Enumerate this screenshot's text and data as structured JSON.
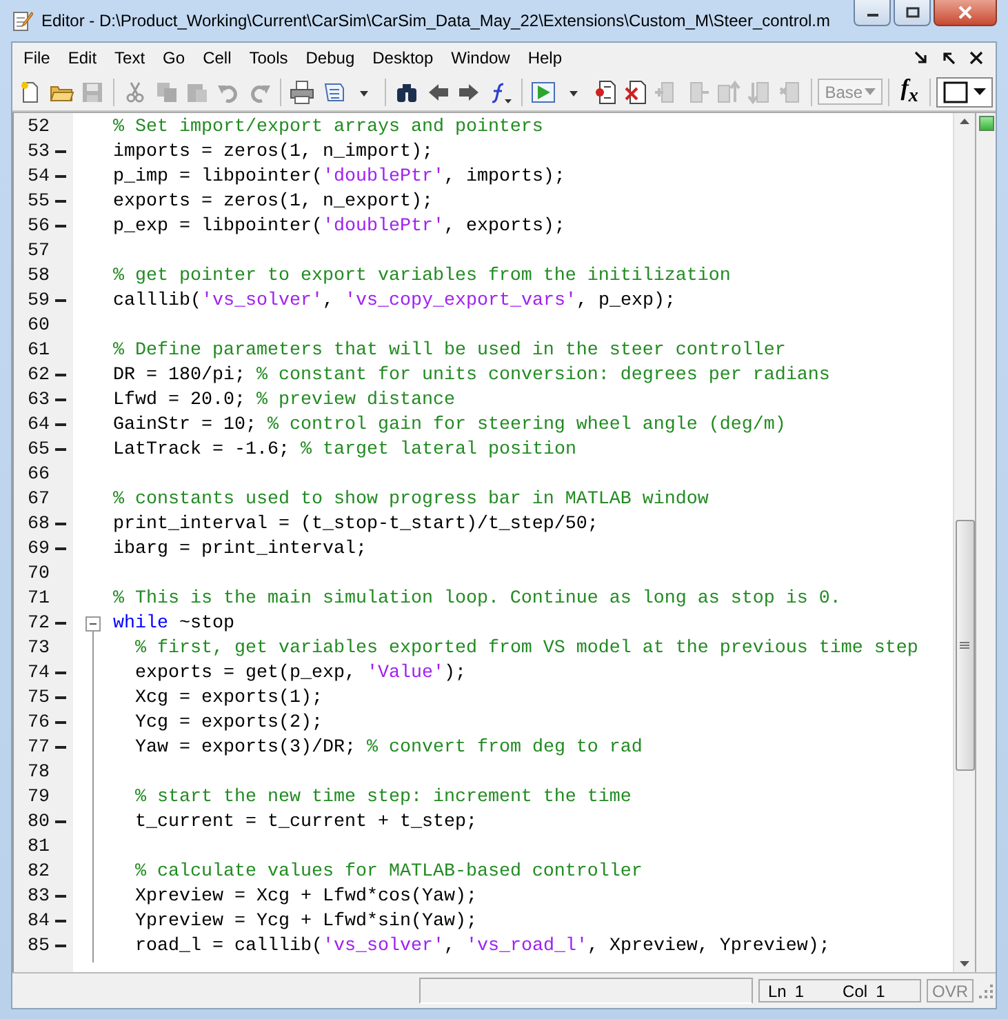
{
  "window": {
    "title": "Editor - D:\\Product_Working\\Current\\CarSim\\CarSim_Data_May_22\\Extensions\\Custom_M\\Steer_control.m"
  },
  "menu": [
    {
      "label": "File"
    },
    {
      "label": "Edit"
    },
    {
      "label": "Text"
    },
    {
      "label": "Go"
    },
    {
      "label": "Cell"
    },
    {
      "label": "Tools"
    },
    {
      "label": "Debug"
    },
    {
      "label": "Desktop"
    },
    {
      "label": "Window"
    },
    {
      "label": "Help"
    }
  ],
  "toolbar": [
    {
      "disabled": false
    },
    {
      "disabled": false
    },
    {
      "disabled": true
    },
    {
      "disabled": true
    },
    {
      "disabled": true
    },
    {
      "disabled": true
    },
    {
      "disabled": true
    },
    {
      "disabled": true
    },
    {
      "disabled": false
    },
    {
      "disabled": false
    },
    {
      "disabled": false
    },
    {
      "disabled": false
    },
    {
      "disabled": false
    },
    {
      "disabled": false
    },
    {
      "disabled": false
    },
    {
      "disabled": false
    },
    {
      "disabled": false
    },
    {
      "disabled": false
    },
    {
      "disabled": false
    },
    {
      "disabled": true
    },
    {
      "disabled": true
    },
    {
      "disabled": true
    },
    {
      "disabled": true
    },
    {
      "disabled": true
    }
  ],
  "stack_dropdown": {
    "value": "Base",
    "disabled": true
  },
  "function_button": {
    "label": "f$_{x}$"
  },
  "lines": [
    {
      "number": "52",
      "executable": false,
      "segments": [
        {
          "kind": "comment",
          "text": "% Set import/export arrays and pointers"
        }
      ]
    },
    {
      "number": "53",
      "executable": true,
      "segments": [
        {
          "kind": "code",
          "text": "imports = zeros(1, n_import);"
        }
      ]
    },
    {
      "number": "54",
      "executable": true,
      "segments": [
        {
          "kind": "code",
          "text": "p_imp = libpointer("
        },
        {
          "kind": "string",
          "text": "'doublePtr'"
        },
        {
          "kind": "code",
          "text": ", imports);"
        }
      ]
    },
    {
      "number": "55",
      "executable": true,
      "segments": [
        {
          "kind": "code",
          "text": "exports = zeros(1, n_export);"
        }
      ]
    },
    {
      "number": "56",
      "executable": true,
      "segments": [
        {
          "kind": "code",
          "text": "p_exp = libpointer("
        },
        {
          "kind": "string",
          "text": "'doublePtr'"
        },
        {
          "kind": "code",
          "text": ", exports);"
        }
      ]
    },
    {
      "number": "57",
      "executable": false
    },
    {
      "number": "58",
      "executable": false,
      "segments": [
        {
          "kind": "comment",
          "text": "% get pointer to export variables from the initilization"
        }
      ]
    },
    {
      "number": "59",
      "executable": true,
      "segments": [
        {
          "kind": "code",
          "text": "calllib("
        },
        {
          "kind": "string",
          "text": "'vs_solver'"
        },
        {
          "kind": "code",
          "text": ", "
        },
        {
          "kind": "string",
          "text": "'vs_copy_export_vars'"
        },
        {
          "kind": "code",
          "text": ", p_exp);"
        }
      ]
    },
    {
      "number": "60",
      "executable": false
    },
    {
      "number": "61",
      "executable": false,
      "segments": [
        {
          "kind": "comment",
          "text": "% Define parameters that will be used in the steer controller"
        }
      ]
    },
    {
      "number": "62",
      "executable": true,
      "segments": [
        {
          "kind": "code",
          "text": "DR = 180/pi; "
        },
        {
          "kind": "comment",
          "text": "% constant for units conversion: degrees per radians"
        }
      ]
    },
    {
      "number": "63",
      "executable": true,
      "segments": [
        {
          "kind": "code",
          "text": "Lfwd = 20.0; "
        },
        {
          "kind": "comment",
          "text": "% preview distance"
        }
      ]
    },
    {
      "number": "64",
      "executable": true,
      "segments": [
        {
          "kind": "code",
          "text": "GainStr = 10; "
        },
        {
          "kind": "comment",
          "text": "% control gain for steering wheel angle (deg/m)"
        }
      ]
    },
    {
      "number": "65",
      "executable": true,
      "segments": [
        {
          "kind": "code",
          "text": "LatTrack = -1.6; "
        },
        {
          "kind": "comment",
          "text": "% target lateral position"
        }
      ]
    },
    {
      "number": "66",
      "executable": false
    },
    {
      "number": "67",
      "executable": false,
      "segments": [
        {
          "kind": "comment",
          "text": "% constants used to show progress bar in MATLAB window"
        }
      ]
    },
    {
      "number": "68",
      "executable": true,
      "segments": [
        {
          "kind": "code",
          "text": "print_interval = (t_stop-t_start)/t_step/50;"
        }
      ]
    },
    {
      "number": "69",
      "executable": true,
      "segments": [
        {
          "kind": "code",
          "text": "ibarg = print_interval;"
        }
      ]
    },
    {
      "number": "70",
      "executable": false
    },
    {
      "number": "71",
      "executable": false,
      "segments": [
        {
          "kind": "comment",
          "text": "% This is the main simulation loop. Continue as long as stop is 0."
        }
      ]
    },
    {
      "number": "72",
      "executable": true,
      "expanded": true,
      "segments": [
        {
          "kind": "keyword",
          "text": "while"
        },
        {
          "kind": "code",
          "text": " ~stop"
        }
      ],
      "children": [
        {
          "number": "73",
          "executable": false,
          "segments": [
            {
              "kind": "comment",
              "text": "% first, get variables exported from VS model at the previous time step"
            }
          ]
        },
        {
          "number": "74",
          "executable": true,
          "segments": [
            {
              "kind": "code",
              "text": "exports = get(p_exp, "
            },
            {
              "kind": "string",
              "text": "'Value'"
            },
            {
              "kind": "code",
              "text": ");"
            }
          ]
        },
        {
          "number": "75",
          "executable": true,
          "segments": [
            {
              "kind": "code",
              "text": "Xcg = exports(1);"
            }
          ]
        },
        {
          "number": "76",
          "executable": true,
          "segments": [
            {
              "kind": "code",
              "text": "Ycg = exports(2);"
            }
          ]
        },
        {
          "number": "77",
          "executable": true,
          "segments": [
            {
              "kind": "code",
              "text": "Yaw = exports(3)/DR; "
            },
            {
              "kind": "comment",
              "text": "% convert from deg to rad"
            }
          ]
        },
        {
          "number": "78",
          "executable": false
        },
        {
          "number": "79",
          "executable": false,
          "segments": [
            {
              "kind": "comment",
              "text": "% start the new time step: increment the time"
            }
          ]
        },
        {
          "number": "80",
          "executable": true,
          "segments": [
            {
              "kind": "code",
              "text": "t_current = t_current + t_step;"
            }
          ]
        },
        {
          "number": "81",
          "executable": false
        },
        {
          "number": "82",
          "executable": false,
          "segments": [
            {
              "kind": "comment",
              "text": "% calculate values for MATLAB-based controller"
            }
          ]
        },
        {
          "number": "83",
          "executable": true,
          "segments": [
            {
              "kind": "code",
              "text": "Xpreview = Xcg + Lfwd*cos(Yaw);"
            }
          ]
        },
        {
          "number": "84",
          "executable": true,
          "segments": [
            {
              "kind": "code",
              "text": "Ypreview = Ycg + Lfwd*sin(Yaw);"
            }
          ]
        },
        {
          "number": "85",
          "executable": true,
          "segments": [
            {
              "kind": "code",
              "text": "road_l = calllib("
            },
            {
              "kind": "string",
              "text": "'vs_solver'"
            },
            {
              "kind": "code",
              "text": ", "
            },
            {
              "kind": "string",
              "text": "'vs_road_l'"
            },
            {
              "kind": "code",
              "text": ", Xpreview, Ypreview);"
            }
          ]
        }
      ]
    }
  ],
  "status_bar": {
    "line_label": "Ln",
    "line": "1",
    "col_label": "Col",
    "col": "1",
    "mode": "OVR"
  }
}
